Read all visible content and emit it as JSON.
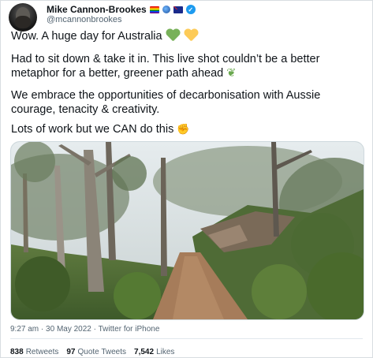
{
  "author": {
    "display_name": "Mike Cannon-Brookes",
    "handle": "@mcannonbrookes",
    "badges": [
      "rainbow-flag-icon",
      "globe-icon",
      "australian-flag-icon",
      "verified-badge-icon"
    ]
  },
  "tweet": {
    "line1": "Wow. A huge day for Australia",
    "line2": "Had to sit down & take it in. This live shot couldn’t be a better metaphor for a better, greener path ahead",
    "line3": "We embrace the opportunities of decarbonisation with Aussie courage, tenacity & creativity.",
    "line4": "Lots of work but we CAN do this",
    "emoji_line1": [
      "green-heart-icon",
      "yellow-heart-icon"
    ],
    "emoji_line2": "seedling-icon",
    "emoji_line4": "raised-fist-icon",
    "seedling_glyph": "❦",
    "fist_glyph": "✊"
  },
  "photo": {
    "alt_subject": "forest-walking-track-photo"
  },
  "meta": {
    "time": "9:27 am",
    "date": "30 May 2022",
    "source": "Twitter for iPhone",
    "separator": "·"
  },
  "stats": {
    "retweets_count": "838",
    "retweets_label": "Retweets",
    "quotes_count": "97",
    "quotes_label": "Quote Tweets",
    "likes_count": "7,542",
    "likes_label": "Likes"
  },
  "colors": {
    "text": "#0f1419",
    "secondary": "#536471",
    "verified": "#1d9bf0",
    "green_heart": "#78b159",
    "yellow_heart": "#fdcb58"
  }
}
